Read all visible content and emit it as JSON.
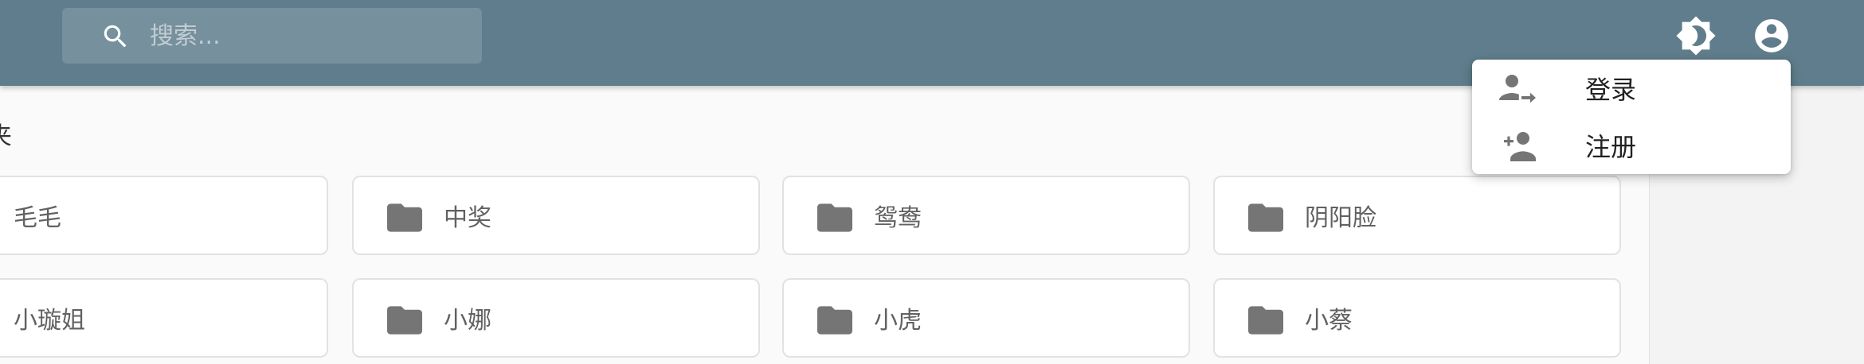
{
  "search": {
    "placeholder": "搜索..."
  },
  "topbar": {
    "theme_icon": "brightness-icon",
    "account_icon": "account-circle-icon"
  },
  "main": {
    "section_title": "夹",
    "folders": [
      {
        "name": "毛毛",
        "icon": ""
      },
      {
        "name": "中奖",
        "icon": "folder-icon"
      },
      {
        "name": "鸳鸯",
        "icon": "folder-icon"
      },
      {
        "name": "阴阳脸",
        "icon": "folder-icon"
      },
      {
        "name": "小璇姐",
        "icon": ""
      },
      {
        "name": "小娜",
        "icon": "folder-icon"
      },
      {
        "name": "小虎",
        "icon": "folder-icon"
      },
      {
        "name": "小蔡",
        "icon": "folder-icon"
      }
    ]
  },
  "account_menu": {
    "items": [
      {
        "label": "登录",
        "icon": "login-icon"
      },
      {
        "label": "注册",
        "icon": "person-add-icon"
      }
    ]
  },
  "colors": {
    "appbar": "#5f7d8c",
    "folder_icon": "#757575",
    "text": "#616161"
  }
}
